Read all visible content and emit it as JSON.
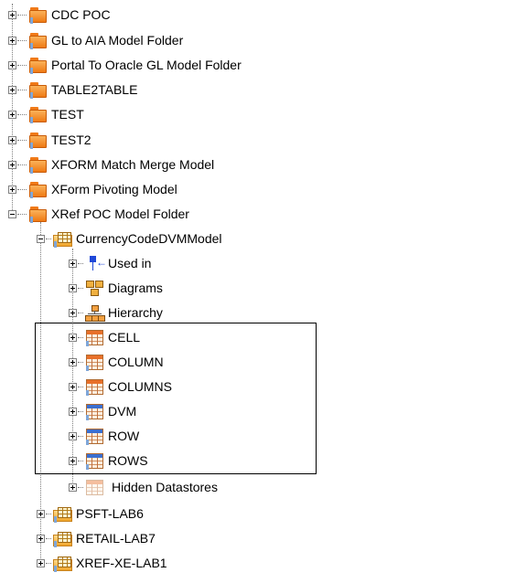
{
  "tree": {
    "folders": [
      {
        "label": "CDC POC",
        "expanded": false
      },
      {
        "label": "GL to AIA Model Folder",
        "expanded": false
      },
      {
        "label": "Portal To Oracle GL Model Folder",
        "expanded": false
      },
      {
        "label": "TABLE2TABLE",
        "expanded": false
      },
      {
        "label": "TEST",
        "expanded": false
      },
      {
        "label": "TEST2",
        "expanded": false
      },
      {
        "label": "XFORM Match Merge Model",
        "expanded": false
      },
      {
        "label": "XForm Pivoting Model",
        "expanded": false
      },
      {
        "label": "XRef POC Model Folder",
        "expanded": true
      }
    ],
    "model": {
      "label": "CurrencyCodeDVMModel",
      "expanded": true
    },
    "model_children": [
      {
        "label": "Used in",
        "icon": "used-in-icon"
      },
      {
        "label": "Diagrams",
        "icon": "diagrams-icon"
      },
      {
        "label": "Hierarchy",
        "icon": "hierarchy-icon"
      }
    ],
    "datastores": [
      {
        "label": "CELL",
        "icon": "datastore-icon"
      },
      {
        "label": "COLUMN",
        "icon": "datastore-icon"
      },
      {
        "label": "COLUMNS",
        "icon": "datastore-icon"
      },
      {
        "label": "DVM",
        "icon": "datastore-blue-icon"
      },
      {
        "label": "ROW",
        "icon": "datastore-blue-icon"
      },
      {
        "label": "ROWS",
        "icon": "datastore-blue-icon"
      }
    ],
    "hidden_datastores": {
      "label": "Hidden Datastores",
      "icon": "hidden-datastores-icon"
    },
    "other_models": [
      {
        "label": "PSFT-LAB6"
      },
      {
        "label": "RETAIL-LAB7"
      },
      {
        "label": "XREF-XE-LAB1"
      }
    ]
  }
}
